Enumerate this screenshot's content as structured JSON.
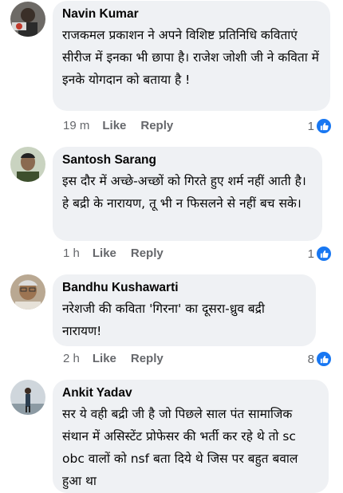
{
  "comments": [
    {
      "author": "Navin Kumar",
      "text": "राजकमल प्रकाशन ने अपने विशिष्ट प्रतिनिधि कविताएं सीरीज में इनका भी छापा है। राजेश जोशी जी ने कविता में इनके योगदान को बताया है !",
      "time": "19 m",
      "like": "Like",
      "reply": "Reply",
      "reactions": "1",
      "reaction_icon": "thumbs-up-icon"
    },
    {
      "author": "Santosh Sarang",
      "text": "इस दौर में अच्छे-अच्छों को गिरते हुए शर्म नहीं आती है। हे बद्री के नारायण, तू भी न फिसलने से नहीं बच सके।",
      "time": "1 h",
      "like": "Like",
      "reply": "Reply",
      "reactions": "1",
      "reaction_icon": "thumbs-up-icon"
    },
    {
      "author": "Bandhu Kushawarti",
      "text": "नरेशजी की कविता 'गिरना' का दूसरा-ध्रुव बद्री नारायण!",
      "time": "2 h",
      "like": "Like",
      "reply": "Reply",
      "reactions": "8",
      "reaction_icon": "thumbs-up-icon"
    },
    {
      "author": "Ankit Yadav",
      "text": "सर ये वही बद्री जी है जो पिछले साल पंत सामाजिक संथान में असिस्टेंट प्रोफेसर की भर्ती कर रहे थे तो  sc obc वालों को nsf बता दिये थे जिस पर बहुत बवाल हुआ था",
      "time": "",
      "like": "",
      "reply": "",
      "reactions": "",
      "reaction_icon": ""
    }
  ],
  "colors": {
    "bubble": "#eff1f4",
    "meta": "#65676b",
    "like_blue": "#1877f2",
    "text": "#050505"
  }
}
